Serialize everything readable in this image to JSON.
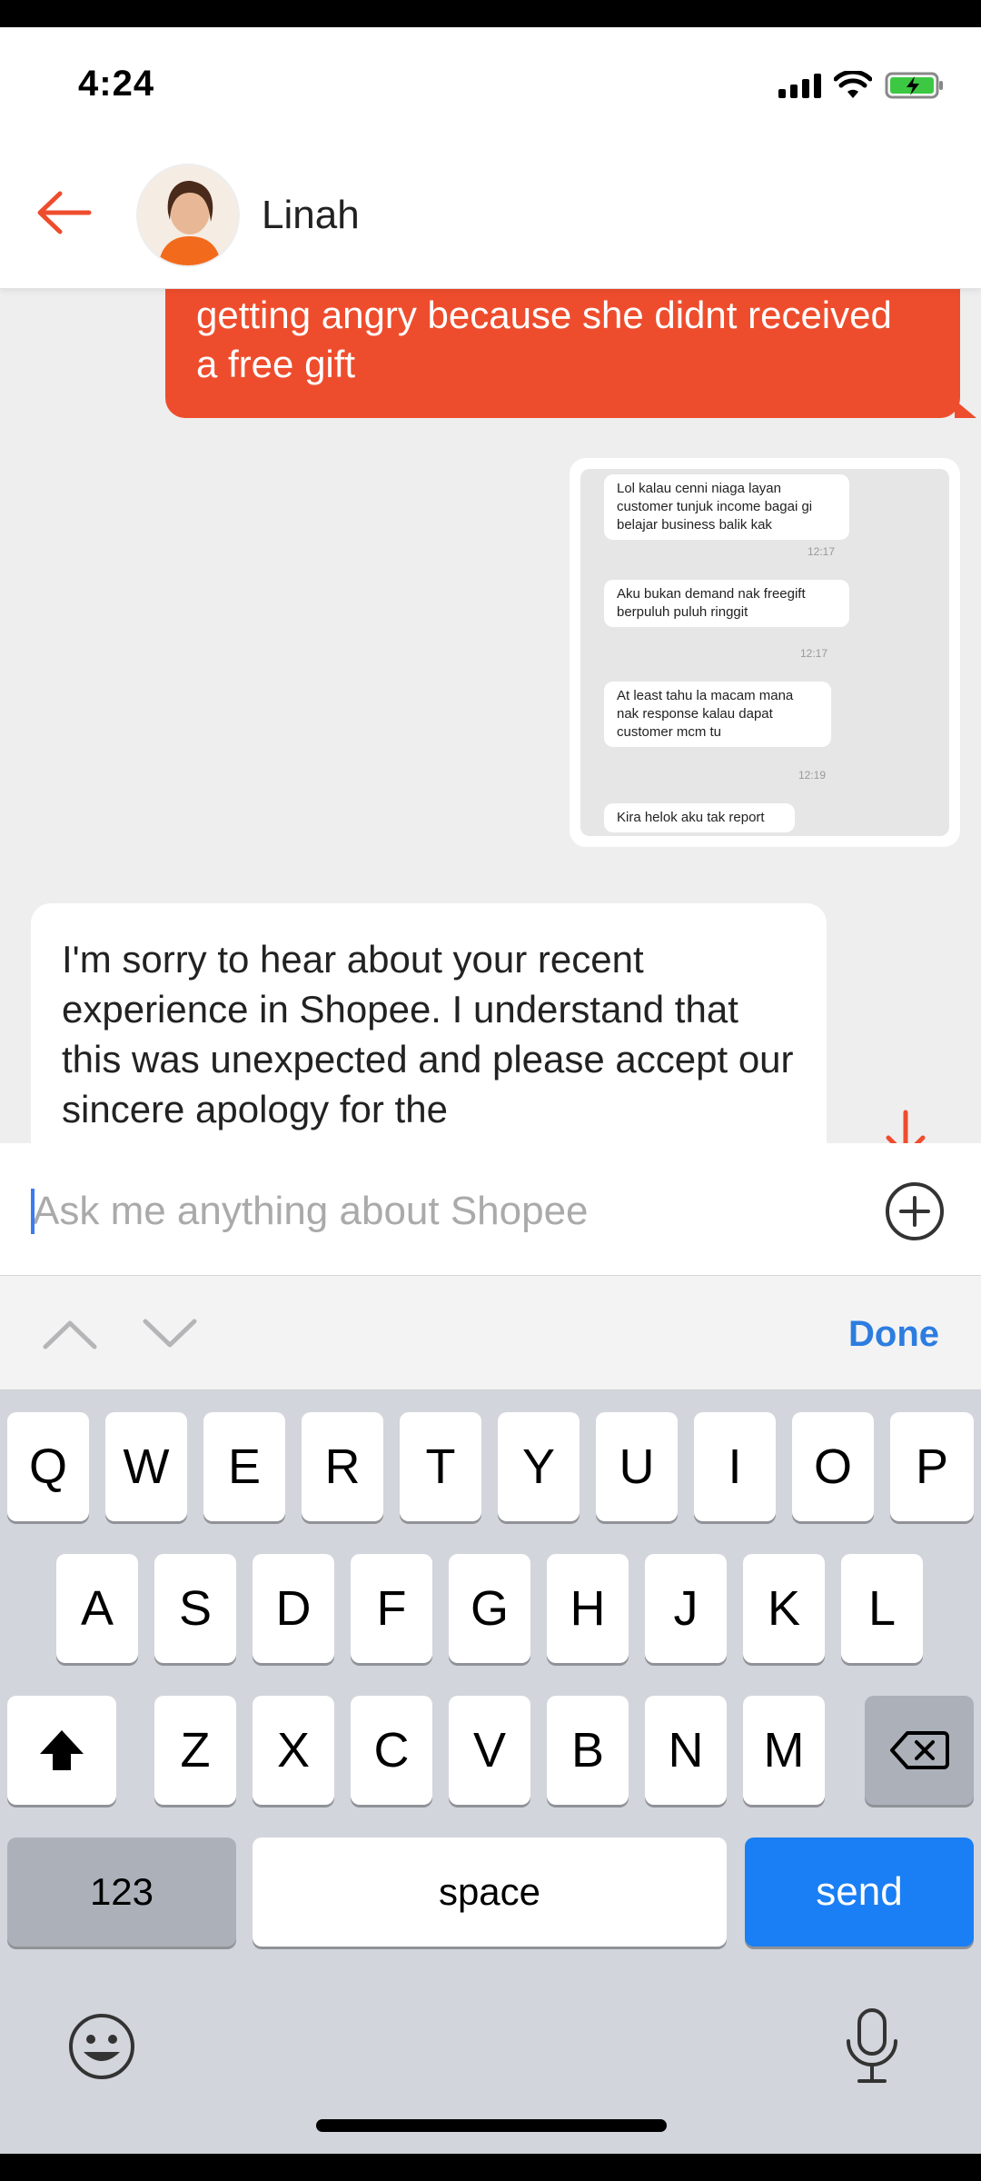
{
  "status_bar": {
    "time": "4:24"
  },
  "header": {
    "contact_name": "Linah"
  },
  "messages": {
    "outgoing_text": "getting angry because she didnt received a free gift",
    "screenshot_messages": [
      {
        "text": "Lol kalau cenni niaga layan customer tunjuk income bagai gi belajar business balik kak",
        "time": "12:17"
      },
      {
        "text": "Aku bukan demand nak freegift berpuluh puluh ringgit",
        "time": "12:17"
      },
      {
        "text": "At least tahu la macam mana nak response kalau dapat customer mcm tu",
        "time": "12:19"
      },
      {
        "text": "Kira helok aku tak report",
        "time": ""
      }
    ],
    "incoming_text": "I'm sorry to hear about your recent experience in Shopee. I understand that this was unexpected and please accept our sincere apology for the"
  },
  "input": {
    "placeholder": "Ask me anything about Shopee"
  },
  "accessory": {
    "done_label": "Done"
  },
  "keyboard": {
    "row1": [
      "Q",
      "W",
      "E",
      "R",
      "T",
      "Y",
      "U",
      "I",
      "O",
      "P"
    ],
    "row2": [
      "A",
      "S",
      "D",
      "F",
      "G",
      "H",
      "J",
      "K",
      "L"
    ],
    "row3": [
      "Z",
      "X",
      "C",
      "V",
      "B",
      "N",
      "M"
    ],
    "numbers_label": "123",
    "space_label": "space",
    "send_label": "send"
  },
  "colors": {
    "accent": "#ee4d2d",
    "send_key": "#1a7ef5",
    "done": "#2d7de0"
  },
  "icons": [
    "back-arrow-icon",
    "add-circle-icon",
    "scroll-down-arrow-icon",
    "chevron-up-icon",
    "chevron-down-icon",
    "shift-icon",
    "backspace-icon",
    "emoji-icon",
    "microphone-icon"
  ]
}
